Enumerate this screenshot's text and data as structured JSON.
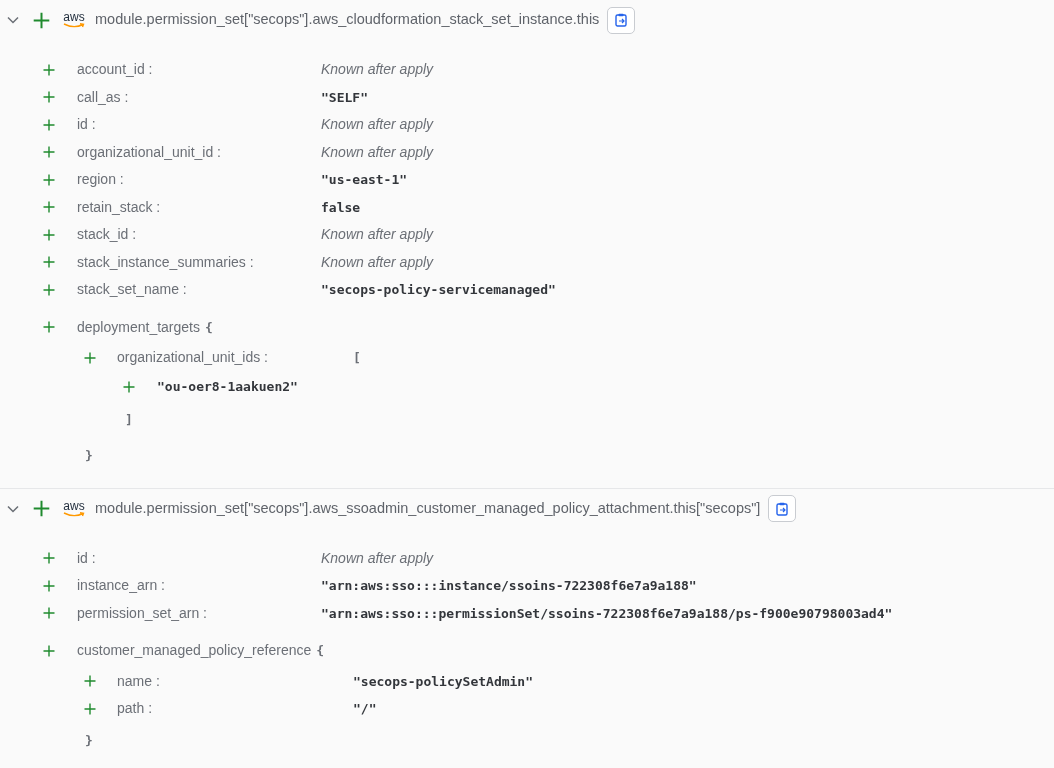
{
  "resources": [
    {
      "expanded": true,
      "logo_text": "aws",
      "title": "module.permission_set[\"secops\"].aws_cloudformation_stack_set_instance.this",
      "attributes": [
        {
          "name": "account_id :",
          "value": "Known after apply",
          "kind": "computed"
        },
        {
          "name": "call_as :",
          "value": "\"SELF\"",
          "kind": "value"
        },
        {
          "name": "id :",
          "value": "Known after apply",
          "kind": "computed"
        },
        {
          "name": "organizational_unit_id :",
          "value": "Known after apply",
          "kind": "computed"
        },
        {
          "name": "region :",
          "value": "\"us-east-1\"",
          "kind": "value"
        },
        {
          "name": "retain_stack :",
          "value": "false",
          "kind": "value"
        },
        {
          "name": "stack_id :",
          "value": "Known after apply",
          "kind": "computed"
        },
        {
          "name": "stack_instance_summaries :",
          "value": "Known after apply",
          "kind": "computed"
        },
        {
          "name": "stack_set_name :",
          "value": "\"secops-policy-servicemanaged\"",
          "kind": "value"
        }
      ],
      "blocks": [
        {
          "name": "deployment_targets",
          "open": "{",
          "close": "}",
          "attributes": [
            {
              "name": "organizational_unit_ids :",
              "kind": "list",
              "open": "[",
              "items": [
                "\"ou-oer8-1aakuen2\""
              ],
              "close": "]"
            }
          ]
        }
      ]
    },
    {
      "expanded": true,
      "logo_text": "aws",
      "title": "module.permission_set[\"secops\"].aws_ssoadmin_customer_managed_policy_attachment.this[\"secops\"]",
      "attributes": [
        {
          "name": "id :",
          "value": "Known after apply",
          "kind": "computed"
        },
        {
          "name": "instance_arn :",
          "value": "\"arn:aws:sso:::instance/ssoins-722308f6e7a9a188\"",
          "kind": "value"
        },
        {
          "name": "permission_set_arn :",
          "value": "\"arn:aws:sso:::permissionSet/ssoins-722308f6e7a9a188/ps-f900e90798003ad4\"",
          "kind": "value"
        }
      ],
      "blocks": [
        {
          "name": "customer_managed_policy_reference",
          "open": "{",
          "close": "}",
          "attributes": [
            {
              "name": "name :",
              "value": "\"secops-policySetAdmin\"",
              "kind": "value"
            },
            {
              "name": "path :",
              "value": "\"/\"",
              "kind": "value"
            }
          ]
        }
      ]
    }
  ]
}
